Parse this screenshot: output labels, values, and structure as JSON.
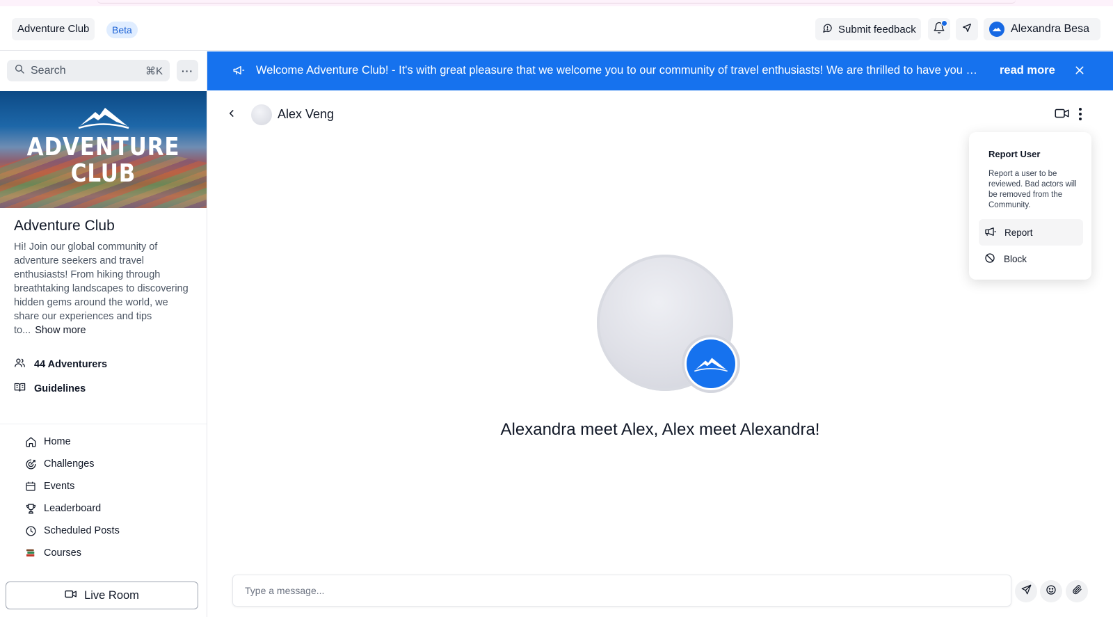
{
  "header": {
    "club_name": "Adventure Club",
    "beta_label": "Beta",
    "feedback_label": "Submit feedback",
    "user_name": "Alexandra Besa"
  },
  "sidebar": {
    "search_placeholder": "Search",
    "search_shortcut": "⌘K",
    "more_label": "···",
    "banner_text_line1": "ADVENTURE",
    "banner_text_line2": "CLUB",
    "club_title": "Adventure Club",
    "club_description": "Hi! Join our global community of adventure seekers and travel enthusiasts! From hiking through breathtaking landscapes to discovering hidden gems around the world, we share our experiences and tips to...",
    "show_more": "Show more",
    "members_label": "44 Adventurers",
    "guidelines_label": "Guidelines",
    "nav": [
      {
        "label": "Home",
        "icon": "home-icon"
      },
      {
        "label": "Challenges",
        "icon": "target-icon"
      },
      {
        "label": "Events",
        "icon": "calendar-icon"
      },
      {
        "label": "Leaderboard",
        "icon": "trophy-icon"
      },
      {
        "label": "Scheduled Posts",
        "icon": "clock-icon"
      },
      {
        "label": "Courses",
        "icon": "books-icon"
      }
    ],
    "live_room_label": "Live Room"
  },
  "announcement": {
    "message": "Welcome Adventure Club! - It's with great pleasure that we welcome you to our community of travel enthusiasts! We are thrilled to have you here",
    "read_more": "read more",
    "bg_color": "#1672ee"
  },
  "chat": {
    "contact_name": "Alex Veng",
    "intro_text": "Alexandra meet Alex, Alex meet Alexandra!",
    "composer_placeholder": "Type a message..."
  },
  "menu": {
    "title": "Report User",
    "description": "Report a user to be reviewed. Bad actors will be removed from the Community.",
    "report_label": "Report",
    "block_label": "Block"
  },
  "colors": {
    "accent": "#1672ee",
    "beta_bg": "#e0edff",
    "beta_text": "#1d63d6"
  }
}
